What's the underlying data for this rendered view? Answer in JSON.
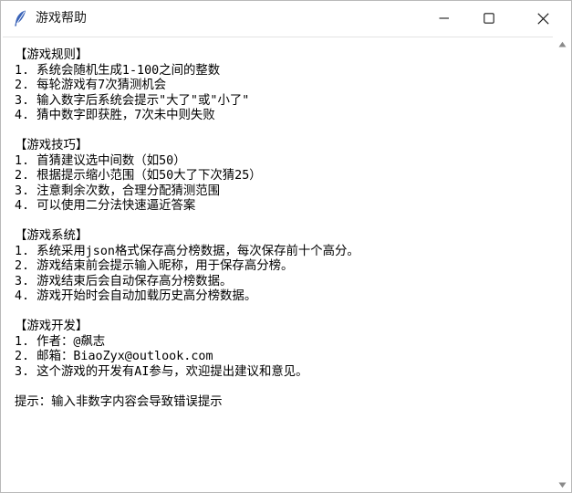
{
  "window": {
    "title": "游戏帮助",
    "icon": "feather-icon"
  },
  "controls": {
    "minimize": "minimize-icon",
    "maximize": "maximize-icon",
    "close": "close-icon"
  },
  "help_text": {
    "lines": [
      "【游戏规则】",
      "1. 系统会随机生成1-100之间的整数",
      "2. 每轮游戏有7次猜测机会",
      "3. 输入数字后系统会提示\"大了\"或\"小了\"",
      "4. 猜中数字即获胜，7次未中则失败",
      "",
      "【游戏技巧】",
      "1. 首猜建议选中间数（如50）",
      "2. 根据提示缩小范围（如50大了下次猜25）",
      "3. 注意剩余次数，合理分配猜测范围",
      "4. 可以使用二分法快速逼近答案",
      "",
      "【游戏系统】",
      "1. 系统采用json格式保存高分榜数据，每次保存前十个高分。",
      "2. 游戏结束前会提示输入昵称，用于保存高分榜。",
      "3. 游戏结束后会自动保存高分榜数据。",
      "4. 游戏开始时会自动加载历史高分榜数据。",
      "",
      "【游戏开发】",
      "1. 作者：@飙志",
      "2. 邮箱：BiaoZyx@outlook.com",
      "3. 这个游戏的开发有AI参与，欢迎提出建议和意见。",
      "",
      "提示：输入非数字内容会导致错误提示"
    ]
  },
  "colors": {
    "background": "#ffffff",
    "text": "#000000",
    "icon_blue": "#3a63b8",
    "scroll_arrow": "#8a8a8a"
  }
}
